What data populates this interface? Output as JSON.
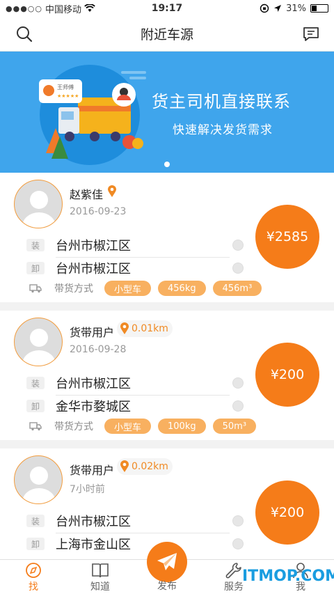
{
  "status": {
    "carrier": "中国移动",
    "time": "19:17",
    "battery": "31%",
    "battery_level": 0.31
  },
  "navbar": {
    "title": "附近车源"
  },
  "banner": {
    "headline": "货主司机直接联系",
    "subline": "快速解决发货需求",
    "badge_name": "王师傅",
    "badge_stars": "★★★★★"
  },
  "cards": [
    {
      "name": "赵紫佳",
      "distance": "",
      "date": "2016-09-23",
      "load_tag": "装",
      "load_city": "台州市椒江区",
      "unload_tag": "卸",
      "unload_city": "台州市椒江区",
      "mode_label": "带货方式",
      "pills": [
        "小型车",
        "456kg",
        "456m³"
      ],
      "price": "¥2585"
    },
    {
      "name": "货带用户",
      "distance": "0.01km",
      "date": "2016-09-28",
      "load_tag": "装",
      "load_city": "台州市椒江区",
      "unload_tag": "卸",
      "unload_city": "金华市婺城区",
      "mode_label": "带货方式",
      "pills": [
        "小型车",
        "100kg",
        "50m³"
      ],
      "price": "¥200"
    },
    {
      "name": "货带用户",
      "distance": "0.02km",
      "date": "7小时前",
      "load_tag": "装",
      "load_city": "台州市椒江区",
      "unload_tag": "卸",
      "unload_city": "上海市金山区",
      "mode_label": "",
      "pills": [],
      "price": "¥200"
    }
  ],
  "tabs": [
    {
      "label": "找",
      "icon": "compass-icon",
      "active": true
    },
    {
      "label": "知道",
      "icon": "book-icon",
      "active": false
    },
    {
      "label": "发布",
      "icon": "paper-plane-icon",
      "active": false
    },
    {
      "label": "服务",
      "icon": "wrench-icon",
      "active": false
    },
    {
      "label": "我",
      "icon": "user-icon",
      "active": false
    }
  ],
  "watermark": "ITMOP.COM",
  "colors": {
    "accent": "#f57c19",
    "banner": "#3fa5ec",
    "pill": "#f8b060"
  }
}
